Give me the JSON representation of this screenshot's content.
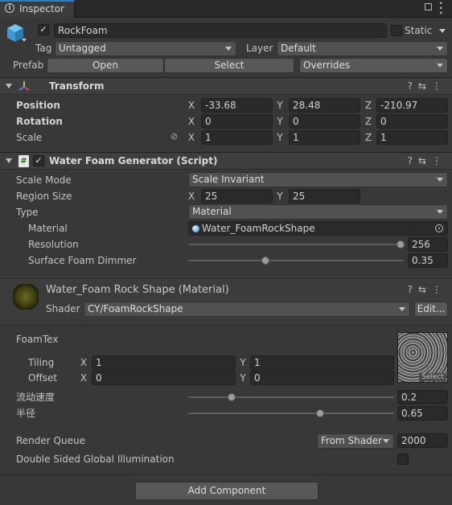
{
  "tab": {
    "title": "Inspector"
  },
  "gameobject": {
    "name": "RockFoam",
    "static_label": "Static",
    "tag_label": "Tag",
    "tag_value": "Untagged",
    "layer_label": "Layer",
    "layer_value": "Default",
    "prefab_label": "Prefab",
    "prefab_open": "Open",
    "prefab_select": "Select",
    "prefab_overrides": "Overrides"
  },
  "transform": {
    "title": "Transform",
    "position_label": "Position",
    "rotation_label": "Rotation",
    "scale_label": "Scale",
    "axis": {
      "x": "X",
      "y": "Y",
      "z": "Z"
    },
    "position": {
      "x": "-33.68",
      "y": "28.48",
      "z": "-210.97"
    },
    "rotation": {
      "x": "0",
      "y": "0",
      "z": "0"
    },
    "scale": {
      "x": "1",
      "y": "1",
      "z": "1"
    }
  },
  "script": {
    "title": "Water Foam Generator (Script)",
    "scale_mode_label": "Scale Mode",
    "scale_mode_value": "Scale Invariant",
    "region_label": "Region Size",
    "region_x": "25",
    "region_y": "25",
    "type_label": "Type",
    "type_value": "Material",
    "material_label": "Material",
    "material_value": "Water_FoamRockShape",
    "resolution_label": "Resolution",
    "resolution_value": "256",
    "dimmer_label": "Surface Foam Dimmer",
    "dimmer_value": "0.35"
  },
  "material": {
    "title": "Water_Foam Rock Shape (Material)",
    "shader_label": "Shader",
    "shader_value": "CY/FoamRockShape",
    "edit_label": "Edit...",
    "foamtex_label": "FoamTex",
    "tiling_label": "Tiling",
    "tiling_x": "1",
    "tiling_y": "1",
    "offset_label": "Offset",
    "offset_x": "0",
    "offset_y": "0",
    "texture_select": "Select",
    "speed_label": "流动速度",
    "speed_value": "0.2",
    "radius_label": "半径",
    "radius_value": "0.65",
    "render_queue_label": "Render Queue",
    "render_queue_source": "From Shader",
    "render_queue_value": "2000",
    "dsgi_label": "Double Sided Global Illumination"
  },
  "footer": {
    "add_component": "Add Component"
  },
  "colors": {
    "accent": "#3a79bb",
    "panel": "#383838",
    "field": "#2a2a2a",
    "header": "#3e3e3e"
  }
}
